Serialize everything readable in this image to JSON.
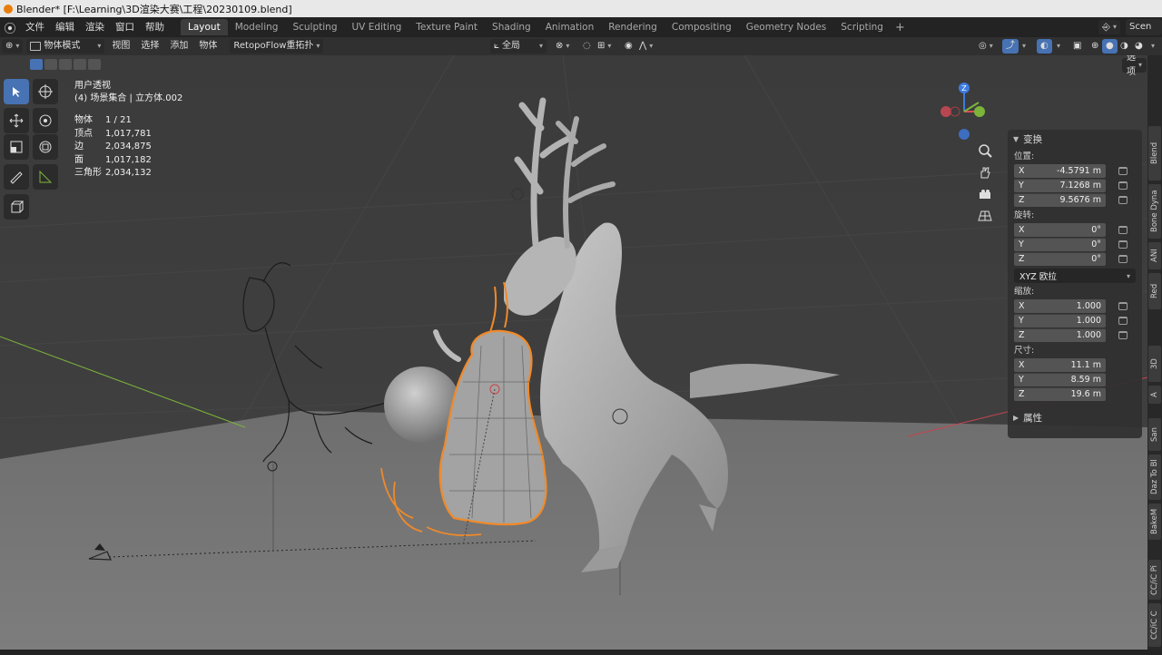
{
  "window": {
    "title": "Blender* [F:\\Learning\\3D渲染大赛\\工程\\20230109.blend]"
  },
  "menu": [
    "文件",
    "编辑",
    "渲染",
    "窗口",
    "帮助"
  ],
  "workspaces": [
    "Layout",
    "Modeling",
    "Sculpting",
    "UV Editing",
    "Texture Paint",
    "Shading",
    "Animation",
    "Rendering",
    "Compositing",
    "Geometry Nodes",
    "Scripting"
  ],
  "active_workspace": "Layout",
  "scene_field": "Scen",
  "header": {
    "mode": "物体模式",
    "view": "视图",
    "select": "选择",
    "add": "添加",
    "object": "物体",
    "addon": "RetopoFlow重拓扑",
    "transform_orientation": "全局",
    "options": "选项"
  },
  "overlay": {
    "view_name": "用户透视",
    "collection": "(4) 场景集合 | 立方体.002",
    "stats": [
      {
        "label": "物体",
        "value": "1 / 21"
      },
      {
        "label": "顶点",
        "value": "1,017,781"
      },
      {
        "label": "边",
        "value": "2,034,875"
      },
      {
        "label": "面",
        "value": "1,017,182"
      },
      {
        "label": "三角形",
        "value": "2,034,132"
      }
    ]
  },
  "gizmo": {
    "z": "Z",
    "y": "Y",
    "x": "X"
  },
  "panel": {
    "transform_title": "变换",
    "location_label": "位置:",
    "location": [
      {
        "axis": "X",
        "value": "-4.5791 m"
      },
      {
        "axis": "Y",
        "value": "7.1268 m"
      },
      {
        "axis": "Z",
        "value": "9.5676 m"
      }
    ],
    "rotation_label": "旋转:",
    "rotation": [
      {
        "axis": "X",
        "value": "0°"
      },
      {
        "axis": "Y",
        "value": "0°"
      },
      {
        "axis": "Z",
        "value": "0°"
      }
    ],
    "rotation_mode": "XYZ 欧拉",
    "scale_label": "缩放:",
    "scale": [
      {
        "axis": "X",
        "value": "1.000"
      },
      {
        "axis": "Y",
        "value": "1.000"
      },
      {
        "axis": "Z",
        "value": "1.000"
      }
    ],
    "dimensions_label": "尺寸:",
    "dimensions": [
      {
        "axis": "X",
        "value": "11.1 m"
      },
      {
        "axis": "Y",
        "value": "8.59 m"
      },
      {
        "axis": "Z",
        "value": "19.6 m"
      }
    ],
    "properties_title": "属性"
  },
  "side_tabs": [
    "Blend",
    "Bone Dyna",
    "ANI",
    "Red",
    "3D",
    "A",
    "San",
    "Daz To Bl",
    "BakeM",
    "CC/iC Pi",
    "CC/iC C"
  ],
  "colors": {
    "selection_orange": "#f08a2a",
    "accent_blue": "#4772b3",
    "axis_x": "#e04b5a",
    "axis_y": "#7cb43a",
    "axis_z": "#3d7be0"
  }
}
